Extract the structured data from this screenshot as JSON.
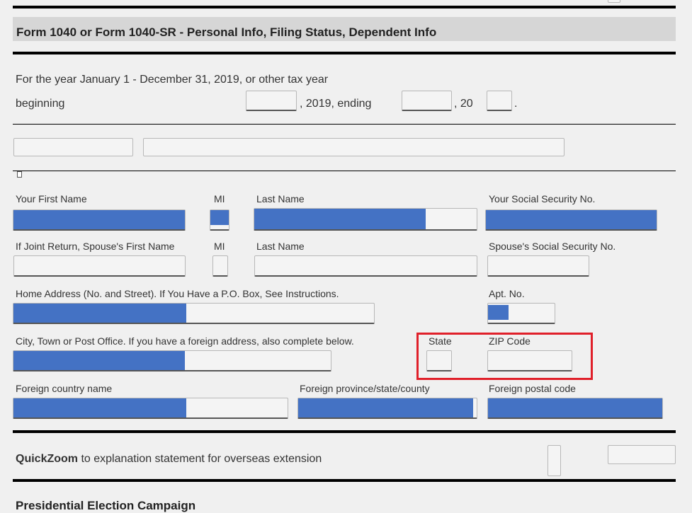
{
  "form": {
    "title": "Form 1040 or Form 1040-SR - Personal Info, Filing Status, Dependent Info"
  },
  "tax_year": {
    "line1": "For the year January 1 - December 31, 2019, or other tax year",
    "beginning": "beginning",
    "year_ending": ", 2019, ending",
    "comma_20": ", 20",
    "period": "."
  },
  "labels": {
    "first_name": "Your First Name",
    "mi": "MI",
    "last_name": "Last Name",
    "ssn": "Your Social Security No.",
    "spouse_first": "If Joint Return, Spouse's First Name",
    "spouse_mi": "MI",
    "spouse_last": "Last Name",
    "spouse_ssn": "Spouse's Social Security No.",
    "home_address": "Home Address (No. and Street). If You Have a P.O. Box, See Instructions.",
    "apt_no": "Apt. No.",
    "city": "City, Town or Post Office. If you have a foreign address, also complete below.",
    "state": "State",
    "zip": "ZIP Code",
    "foreign_country": "Foreign country name",
    "foreign_province": "Foreign province/state/county",
    "foreign_postal": "Foreign postal code"
  },
  "quickzoom": {
    "bold": "QuickZoom",
    "text": " to explanation statement for overseas extension"
  },
  "next_section": {
    "title": "Presidential Election Campaign"
  },
  "fills": {
    "first_name": 1.0,
    "mi": 1.0,
    "last_name": 0.77,
    "ssn": 1.0,
    "home_address": 0.48,
    "apt_no": 0.31,
    "city": 0.54,
    "foreign_country": 0.63,
    "foreign_province": 0.98,
    "foreign_postal": 1.0
  },
  "colors": {
    "redacted_fill": "#4472c4",
    "highlight_border": "#e0202a"
  }
}
